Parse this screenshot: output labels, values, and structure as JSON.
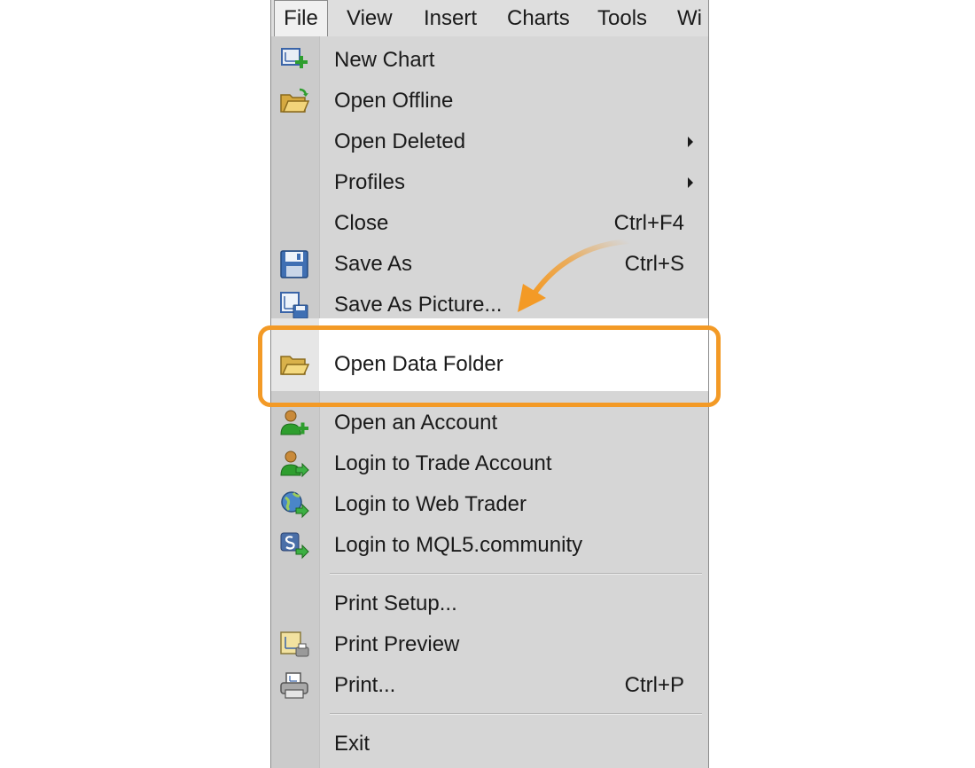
{
  "menubar": {
    "items": [
      {
        "label": "File",
        "active": true
      },
      {
        "label": "View"
      },
      {
        "label": "Insert"
      },
      {
        "label": "Charts"
      },
      {
        "label": "Tools"
      },
      {
        "label": "Wi"
      }
    ]
  },
  "file_menu": {
    "items": [
      {
        "label": "New Chart",
        "icon": "new-chart-icon"
      },
      {
        "label": "Open Offline",
        "icon": "open-offline-icon"
      },
      {
        "label": "Open Deleted",
        "submenu": true
      },
      {
        "label": "Profiles",
        "submenu": true
      },
      {
        "label": "Close",
        "shortcut": "Ctrl+F4"
      },
      {
        "label": "Save As",
        "shortcut": "Ctrl+S",
        "icon": "save-icon"
      },
      {
        "label": "Save As Picture...",
        "icon": "save-picture-icon"
      },
      {
        "label": "Open Data Folder",
        "icon": "folder-icon",
        "highlighted": true
      },
      {
        "label": "Open an Account",
        "icon": "add-user-icon"
      },
      {
        "label": "Login to Trade Account",
        "icon": "login-user-icon"
      },
      {
        "label": "Login to Web Trader",
        "icon": "globe-login-icon"
      },
      {
        "label": "Login to MQL5.community",
        "icon": "mql5-login-icon"
      },
      {
        "label": "Print Setup..."
      },
      {
        "label": "Print Preview",
        "icon": "print-preview-icon"
      },
      {
        "label": "Print...",
        "shortcut": "Ctrl+P",
        "icon": "printer-icon"
      },
      {
        "label": "Exit"
      }
    ]
  },
  "colors": {
    "callout": "#f39a26",
    "menu_bg": "#d6d6d6",
    "gutter_bg": "#cbcbcb"
  }
}
